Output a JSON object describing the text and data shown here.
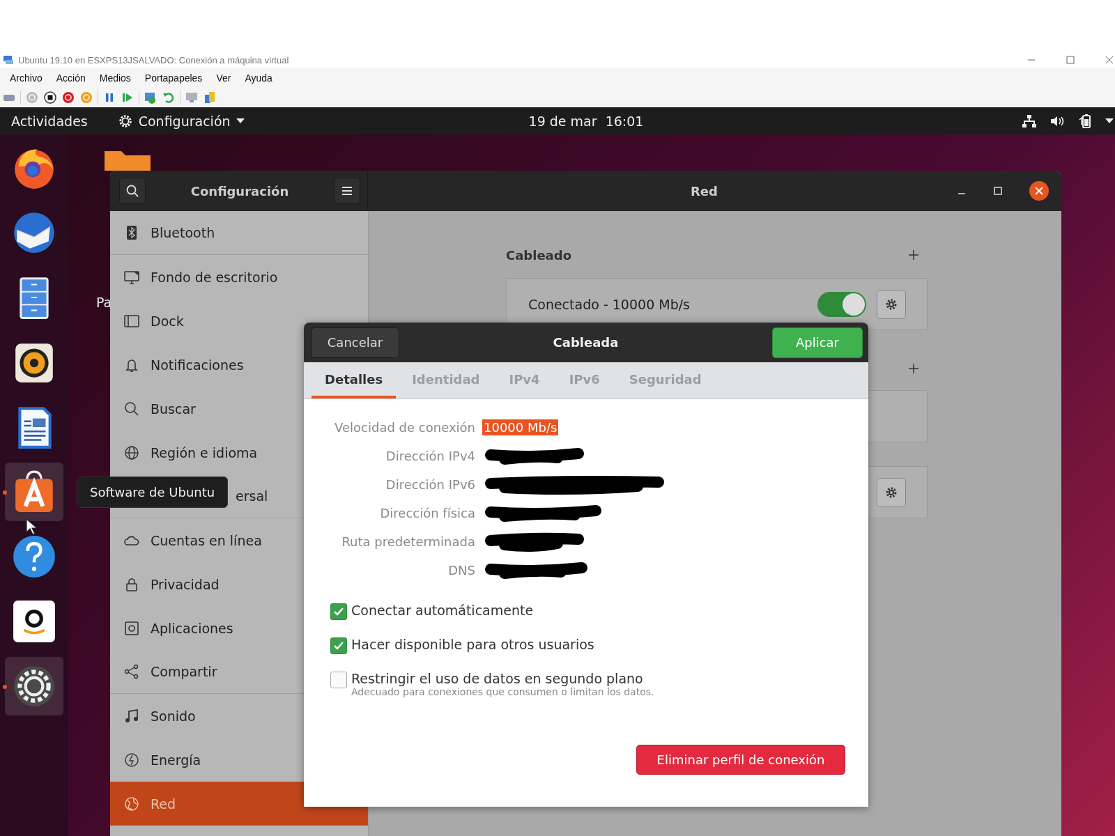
{
  "host_window": {
    "title": "Ubuntu 19.10 en ESXPS13JSALVADO: Conexión a máquina virtual",
    "menu": [
      "Archivo",
      "Acción",
      "Medios",
      "Portapapeles",
      "Ver",
      "Ayuda"
    ]
  },
  "top_bar": {
    "activities": "Actividades",
    "app_menu": "Configuración",
    "clock": "19 de mar  16:01"
  },
  "dock": [
    {
      "kind": "firefox",
      "running": false
    },
    {
      "kind": "mail",
      "running": false
    },
    {
      "kind": "files",
      "running": false
    },
    {
      "kind": "music",
      "running": false
    },
    {
      "kind": "writer",
      "running": false
    },
    {
      "kind": "software",
      "running": true
    },
    {
      "kind": "help",
      "running": false
    },
    {
      "kind": "amazon",
      "running": false
    },
    {
      "kind": "settings",
      "running": true
    }
  ],
  "dock_tooltip": "Software de Ubuntu",
  "desktop_icons": [
    {
      "label": "Pa"
    }
  ],
  "settings": {
    "title": "Configuración",
    "panel_title": "Red",
    "sidebar": [
      {
        "kind": "bluetooth",
        "label": "Bluetooth",
        "selected": false,
        "divider_after": true
      },
      {
        "kind": "background",
        "label": "Fondo de escritorio",
        "selected": false,
        "divider_after": false
      },
      {
        "kind": "dock",
        "label": "Dock",
        "selected": false,
        "divider_after": false
      },
      {
        "kind": "bell",
        "label": "Notificaciones",
        "selected": false,
        "divider_after": false
      },
      {
        "kind": "search",
        "label": "Buscar",
        "selected": false,
        "divider_after": false
      },
      {
        "kind": "globe",
        "label": "Región e idioma",
        "selected": false,
        "divider_after": false
      },
      {
        "kind": "covered",
        "label": "ersal",
        "selected": false,
        "divider_after": true
      },
      {
        "kind": "cloud",
        "label": "Cuentas en línea",
        "selected": false,
        "divider_after": false
      },
      {
        "kind": "lock",
        "label": "Privacidad",
        "selected": false,
        "divider_after": false
      },
      {
        "kind": "apps",
        "label": "Aplicaciones",
        "selected": false,
        "divider_after": false
      },
      {
        "kind": "share",
        "label": "Compartir",
        "selected": false,
        "divider_after": true
      },
      {
        "kind": "note",
        "label": "Sonido",
        "selected": false,
        "divider_after": false
      },
      {
        "kind": "power",
        "label": "Energía",
        "selected": false,
        "divider_after": false
      },
      {
        "kind": "network",
        "label": "Red",
        "selected": true,
        "divider_after": false
      }
    ],
    "wired": {
      "heading": "Cableado",
      "connection": {
        "label": "Conectado - 10000 Mb/s",
        "on": true
      }
    }
  },
  "dialog": {
    "cancel": "Cancelar",
    "title": "Cableada",
    "apply": "Aplicar",
    "tabs": [
      {
        "label": "Detalles",
        "selected": true
      },
      {
        "label": "Identidad",
        "selected": false
      },
      {
        "label": "IPv4",
        "selected": false
      },
      {
        "label": "IPv6",
        "selected": false
      },
      {
        "label": "Seguridad",
        "selected": false
      }
    ],
    "details": [
      {
        "label": "Velocidad de conexión",
        "value": "10000 Mb/s",
        "highlighted": true
      },
      {
        "label": "Dirección IPv4",
        "redacted": true
      },
      {
        "label": "Dirección IPv6",
        "redacted": true
      },
      {
        "label": "Dirección física",
        "redacted": true
      },
      {
        "label": "Ruta predeterminada",
        "redacted": true
      },
      {
        "label": "DNS",
        "redacted": true
      }
    ],
    "options": [
      {
        "label": "Conectar automáticamente",
        "checked": true
      },
      {
        "label": "Hacer disponible para otros usuarios",
        "checked": true
      },
      {
        "label": "Restringir el uso de datos en segundo plano",
        "hint": "Adecuado para conexiones que consumen o limitan los datos.",
        "checked": false
      }
    ],
    "delete": "Eliminar perfil de conexión"
  }
}
